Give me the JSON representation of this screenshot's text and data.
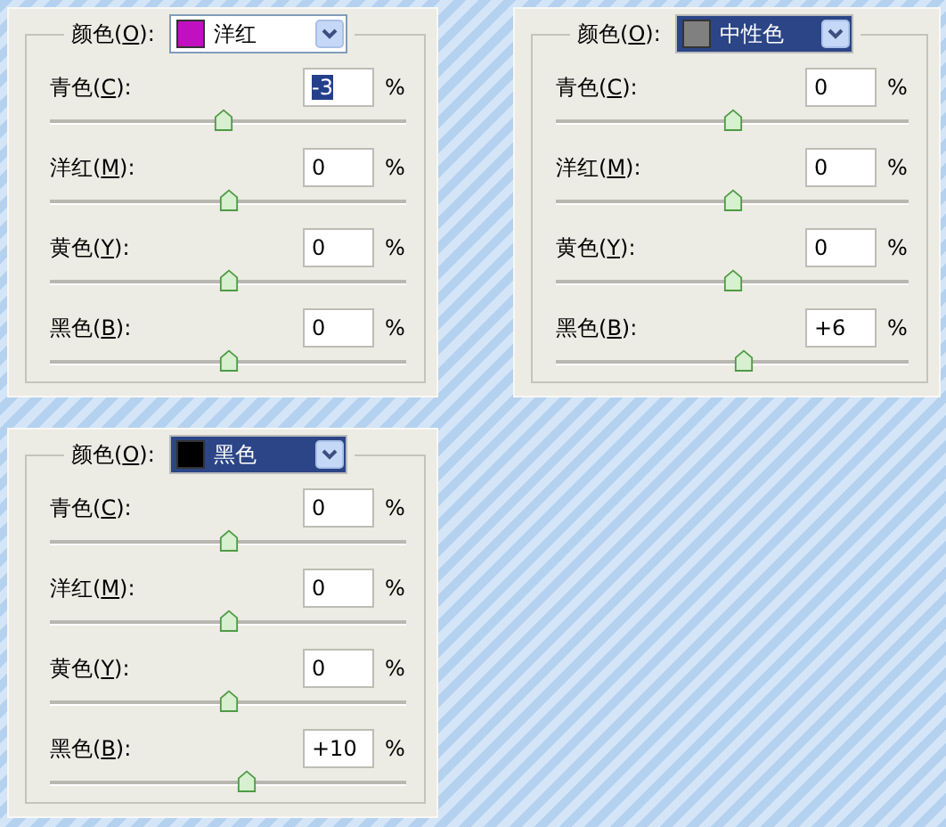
{
  "panels": [
    {
      "color_label": {
        "before": "颜色(",
        "mnemonic": "O",
        "after": "):"
      },
      "dropdown": {
        "value": "洋红",
        "color": "#c010c0",
        "focused": false
      },
      "channels": [
        {
          "label": {
            "before": "青色(",
            "mnemonic": "C",
            "after": "):"
          },
          "value": "-3",
          "selected": true,
          "unit": "%",
          "level": 0.485
        },
        {
          "label": {
            "before": "洋红(",
            "mnemonic": "M",
            "after": "):"
          },
          "value": "0",
          "selected": false,
          "unit": "%",
          "level": 0.5
        },
        {
          "label": {
            "before": "黄色(",
            "mnemonic": "Y",
            "after": "):"
          },
          "value": "0",
          "selected": false,
          "unit": "%",
          "level": 0.5
        },
        {
          "label": {
            "before": "黑色(",
            "mnemonic": "B",
            "after": "):"
          },
          "value": "0",
          "selected": false,
          "unit": "%",
          "level": 0.5
        }
      ]
    },
    {
      "color_label": {
        "before": "颜色(",
        "mnemonic": "O",
        "after": "):"
      },
      "dropdown": {
        "value": "中性色",
        "color": "#808080",
        "focused": true
      },
      "channels": [
        {
          "label": {
            "before": "青色(",
            "mnemonic": "C",
            "after": "):"
          },
          "value": "0",
          "selected": false,
          "unit": "%",
          "level": 0.5
        },
        {
          "label": {
            "before": "洋红(",
            "mnemonic": "M",
            "after": "):"
          },
          "value": "0",
          "selected": false,
          "unit": "%",
          "level": 0.5
        },
        {
          "label": {
            "before": "黄色(",
            "mnemonic": "Y",
            "after": "):"
          },
          "value": "0",
          "selected": false,
          "unit": "%",
          "level": 0.5
        },
        {
          "label": {
            "before": "黑色(",
            "mnemonic": "B",
            "after": "):"
          },
          "value": "+6",
          "selected": false,
          "unit": "%",
          "level": 0.53
        }
      ]
    },
    {
      "color_label": {
        "before": "颜色(",
        "mnemonic": "O",
        "after": "):"
      },
      "dropdown": {
        "value": "黑色",
        "color": "#000000",
        "focused": true
      },
      "channels": [
        {
          "label": {
            "before": "青色(",
            "mnemonic": "C",
            "after": "):"
          },
          "value": "0",
          "selected": false,
          "unit": "%",
          "level": 0.5
        },
        {
          "label": {
            "before": "洋红(",
            "mnemonic": "M",
            "after": "):"
          },
          "value": "0",
          "selected": false,
          "unit": "%",
          "level": 0.5
        },
        {
          "label": {
            "before": "黄色(",
            "mnemonic": "Y",
            "after": "):"
          },
          "value": "0",
          "selected": false,
          "unit": "%",
          "level": 0.5
        },
        {
          "label": {
            "before": "黑色(",
            "mnemonic": "B",
            "after": "):"
          },
          "value": "+10",
          "selected": false,
          "unit": "%",
          "level": 0.55
        }
      ]
    }
  ]
}
